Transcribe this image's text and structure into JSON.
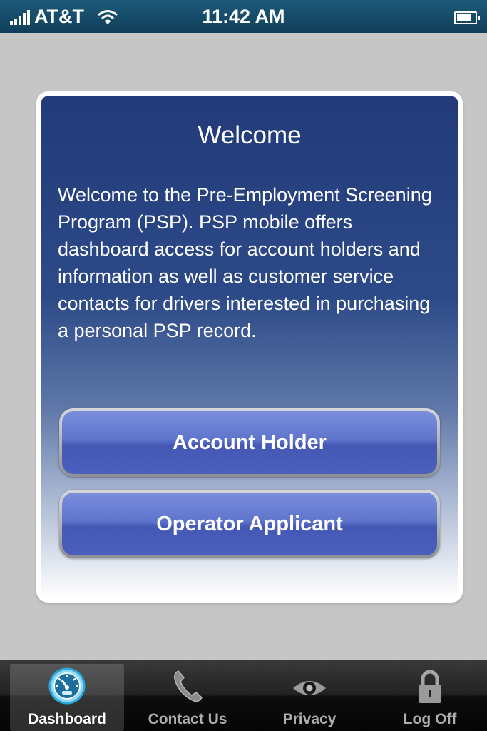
{
  "status_bar": {
    "carrier": "AT&T",
    "time": "11:42 AM",
    "signal_bars": 5,
    "battery_level": 0.8
  },
  "welcome": {
    "title": "Welcome",
    "body": "Welcome to the Pre-Employment Screening Program (PSP). PSP mobile offers dashboard access for account holders and information as well as customer service contacts for drivers interested in purchasing a personal PSP record."
  },
  "buttons": {
    "account_holder": "Account Holder",
    "operator_applicant": "Operator Applicant"
  },
  "tabs": [
    {
      "label": "Dashboard",
      "icon": "speedometer-icon",
      "active": true
    },
    {
      "label": "Contact Us",
      "icon": "phone-icon",
      "active": false
    },
    {
      "label": "Privacy",
      "icon": "eye-icon",
      "active": false
    },
    {
      "label": "Log Off",
      "icon": "lock-icon",
      "active": false
    }
  ],
  "colors": {
    "status_bar": "#154d6d",
    "card_top": "#223a78",
    "button": "#5f75cc",
    "accent_icon": "#39b6e8"
  }
}
